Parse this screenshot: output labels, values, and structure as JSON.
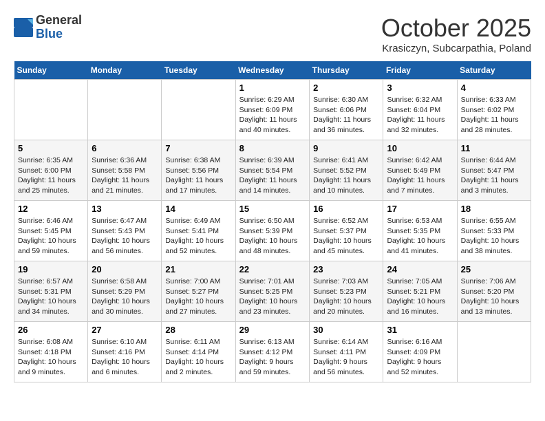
{
  "header": {
    "logo_line1": "General",
    "logo_line2": "Blue",
    "month_title": "October 2025",
    "subtitle": "Krasiczyn, Subcarpathia, Poland"
  },
  "weekdays": [
    "Sunday",
    "Monday",
    "Tuesday",
    "Wednesday",
    "Thursday",
    "Friday",
    "Saturday"
  ],
  "weeks": [
    [
      {
        "day": "",
        "info": ""
      },
      {
        "day": "",
        "info": ""
      },
      {
        "day": "",
        "info": ""
      },
      {
        "day": "1",
        "info": "Sunrise: 6:29 AM\nSunset: 6:09 PM\nDaylight: 11 hours\nand 40 minutes."
      },
      {
        "day": "2",
        "info": "Sunrise: 6:30 AM\nSunset: 6:06 PM\nDaylight: 11 hours\nand 36 minutes."
      },
      {
        "day": "3",
        "info": "Sunrise: 6:32 AM\nSunset: 6:04 PM\nDaylight: 11 hours\nand 32 minutes."
      },
      {
        "day": "4",
        "info": "Sunrise: 6:33 AM\nSunset: 6:02 PM\nDaylight: 11 hours\nand 28 minutes."
      }
    ],
    [
      {
        "day": "5",
        "info": "Sunrise: 6:35 AM\nSunset: 6:00 PM\nDaylight: 11 hours\nand 25 minutes."
      },
      {
        "day": "6",
        "info": "Sunrise: 6:36 AM\nSunset: 5:58 PM\nDaylight: 11 hours\nand 21 minutes."
      },
      {
        "day": "7",
        "info": "Sunrise: 6:38 AM\nSunset: 5:56 PM\nDaylight: 11 hours\nand 17 minutes."
      },
      {
        "day": "8",
        "info": "Sunrise: 6:39 AM\nSunset: 5:54 PM\nDaylight: 11 hours\nand 14 minutes."
      },
      {
        "day": "9",
        "info": "Sunrise: 6:41 AM\nSunset: 5:52 PM\nDaylight: 11 hours\nand 10 minutes."
      },
      {
        "day": "10",
        "info": "Sunrise: 6:42 AM\nSunset: 5:49 PM\nDaylight: 11 hours\nand 7 minutes."
      },
      {
        "day": "11",
        "info": "Sunrise: 6:44 AM\nSunset: 5:47 PM\nDaylight: 11 hours\nand 3 minutes."
      }
    ],
    [
      {
        "day": "12",
        "info": "Sunrise: 6:46 AM\nSunset: 5:45 PM\nDaylight: 10 hours\nand 59 minutes."
      },
      {
        "day": "13",
        "info": "Sunrise: 6:47 AM\nSunset: 5:43 PM\nDaylight: 10 hours\nand 56 minutes."
      },
      {
        "day": "14",
        "info": "Sunrise: 6:49 AM\nSunset: 5:41 PM\nDaylight: 10 hours\nand 52 minutes."
      },
      {
        "day": "15",
        "info": "Sunrise: 6:50 AM\nSunset: 5:39 PM\nDaylight: 10 hours\nand 48 minutes."
      },
      {
        "day": "16",
        "info": "Sunrise: 6:52 AM\nSunset: 5:37 PM\nDaylight: 10 hours\nand 45 minutes."
      },
      {
        "day": "17",
        "info": "Sunrise: 6:53 AM\nSunset: 5:35 PM\nDaylight: 10 hours\nand 41 minutes."
      },
      {
        "day": "18",
        "info": "Sunrise: 6:55 AM\nSunset: 5:33 PM\nDaylight: 10 hours\nand 38 minutes."
      }
    ],
    [
      {
        "day": "19",
        "info": "Sunrise: 6:57 AM\nSunset: 5:31 PM\nDaylight: 10 hours\nand 34 minutes."
      },
      {
        "day": "20",
        "info": "Sunrise: 6:58 AM\nSunset: 5:29 PM\nDaylight: 10 hours\nand 30 minutes."
      },
      {
        "day": "21",
        "info": "Sunrise: 7:00 AM\nSunset: 5:27 PM\nDaylight: 10 hours\nand 27 minutes."
      },
      {
        "day": "22",
        "info": "Sunrise: 7:01 AM\nSunset: 5:25 PM\nDaylight: 10 hours\nand 23 minutes."
      },
      {
        "day": "23",
        "info": "Sunrise: 7:03 AM\nSunset: 5:23 PM\nDaylight: 10 hours\nand 20 minutes."
      },
      {
        "day": "24",
        "info": "Sunrise: 7:05 AM\nSunset: 5:21 PM\nDaylight: 10 hours\nand 16 minutes."
      },
      {
        "day": "25",
        "info": "Sunrise: 7:06 AM\nSunset: 5:20 PM\nDaylight: 10 hours\nand 13 minutes."
      }
    ],
    [
      {
        "day": "26",
        "info": "Sunrise: 6:08 AM\nSunset: 4:18 PM\nDaylight: 10 hours\nand 9 minutes."
      },
      {
        "day": "27",
        "info": "Sunrise: 6:10 AM\nSunset: 4:16 PM\nDaylight: 10 hours\nand 6 minutes."
      },
      {
        "day": "28",
        "info": "Sunrise: 6:11 AM\nSunset: 4:14 PM\nDaylight: 10 hours\nand 2 minutes."
      },
      {
        "day": "29",
        "info": "Sunrise: 6:13 AM\nSunset: 4:12 PM\nDaylight: 9 hours\nand 59 minutes."
      },
      {
        "day": "30",
        "info": "Sunrise: 6:14 AM\nSunset: 4:11 PM\nDaylight: 9 hours\nand 56 minutes."
      },
      {
        "day": "31",
        "info": "Sunrise: 6:16 AM\nSunset: 4:09 PM\nDaylight: 9 hours\nand 52 minutes."
      },
      {
        "day": "",
        "info": ""
      }
    ]
  ]
}
